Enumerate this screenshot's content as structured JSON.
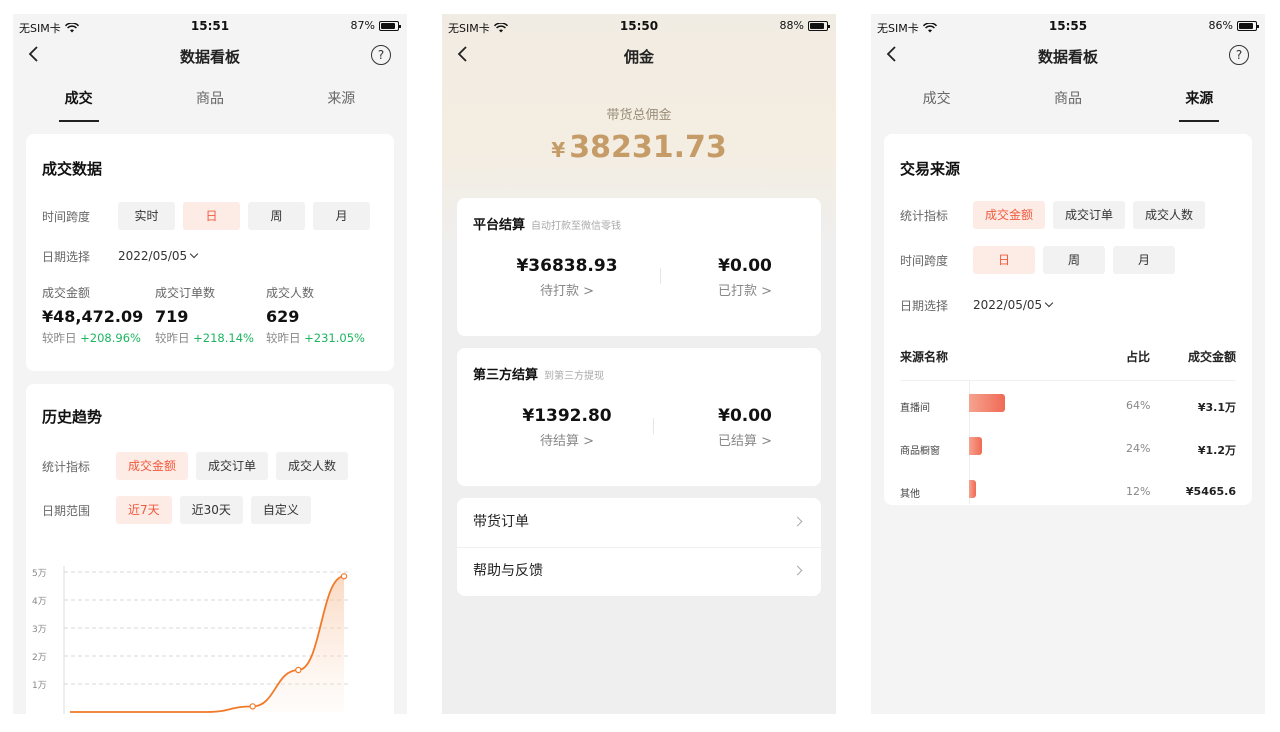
{
  "status_bars": [
    {
      "carrier": "无SIM卡",
      "time": "15:51",
      "battery": "87%",
      "battery_level": 0.87
    },
    {
      "carrier": "无SIM卡",
      "time": "15:50",
      "battery": "88%",
      "battery_level": 0.88
    },
    {
      "carrier": "无SIM卡",
      "time": "15:55",
      "battery": "86%",
      "battery_level": 0.86
    }
  ],
  "screen1": {
    "title": "数据看板",
    "help": "?",
    "tabs": [
      "成交",
      "商品",
      "来源"
    ],
    "card1": {
      "title": "成交数据",
      "span_label": "时间跨度",
      "span_options": [
        "实时",
        "日",
        "周",
        "月"
      ],
      "date_label": "日期选择",
      "date_value": "2022/05/05",
      "metrics": [
        {
          "name": "成交金额",
          "value": "¥48,472.09",
          "cmp": "较昨日",
          "delta": "+208.96%"
        },
        {
          "name": "成交订单数",
          "value": "719",
          "cmp": "较昨日",
          "delta": "+218.14%"
        },
        {
          "name": "成交人数",
          "value": "629",
          "cmp": "较昨日",
          "delta": "+231.05%"
        }
      ]
    },
    "card2": {
      "title": "历史趋势",
      "metric_label": "统计指标",
      "metric_options": [
        "成交金额",
        "成交订单",
        "成交人数"
      ],
      "range_label": "日期范围",
      "range_options": [
        "近7天",
        "近30天",
        "自定义"
      ]
    }
  },
  "chart_data": {
    "type": "area",
    "title": "",
    "ylabel": "",
    "yticks": [
      "1万",
      "2万",
      "3万",
      "4万",
      "5万"
    ],
    "ylim": [
      0,
      50000
    ],
    "x": [
      1,
      2,
      3,
      4,
      5,
      6,
      7
    ],
    "values": [
      0,
      0,
      0,
      0,
      2000,
      15000,
      48472
    ],
    "color": "#f07a2a"
  },
  "screen2": {
    "title": "佣金",
    "total_label": "带货总佣金",
    "currency": "¥",
    "total_value": "38231.73",
    "platform": {
      "title": "平台结算",
      "note": "自动打款至微信零钱",
      "left_value": "¥36838.93",
      "left_label": "待打款 >",
      "right_value": "¥0.00",
      "right_label": "已打款 >"
    },
    "third": {
      "title": "第三方结算",
      "note": "到第三方提现",
      "left_value": "¥1392.80",
      "left_label": "待结算 >",
      "right_value": "¥0.00",
      "right_label": "已结算 >"
    },
    "menu": [
      "带货订单",
      "帮助与反馈"
    ]
  },
  "screen3": {
    "title": "数据看板",
    "help": "?",
    "tabs": [
      "成交",
      "商品",
      "来源"
    ],
    "card": {
      "title": "交易来源",
      "metric_label": "统计指标",
      "metric_options": [
        "成交金额",
        "成交订单",
        "成交人数"
      ],
      "span_label": "时间跨度",
      "span_options": [
        "日",
        "周",
        "月"
      ],
      "date_label": "日期选择",
      "date_value": "2022/05/05",
      "headers": [
        "来源名称",
        "占比",
        "成交金额"
      ],
      "rows": [
        {
          "name": "直播间",
          "pct": "64%",
          "share": 0.64,
          "amount": "¥3.1万"
        },
        {
          "name": "商品橱窗",
          "pct": "24%",
          "share": 0.24,
          "amount": "¥1.2万"
        },
        {
          "name": "其他",
          "pct": "12%",
          "share": 0.12,
          "amount": "¥5465.6"
        }
      ]
    }
  },
  "colors": {
    "accent": "#f05a3c",
    "accent_bg": "#fdebe6",
    "positive": "#1bb560",
    "gold": "#c59b67"
  }
}
